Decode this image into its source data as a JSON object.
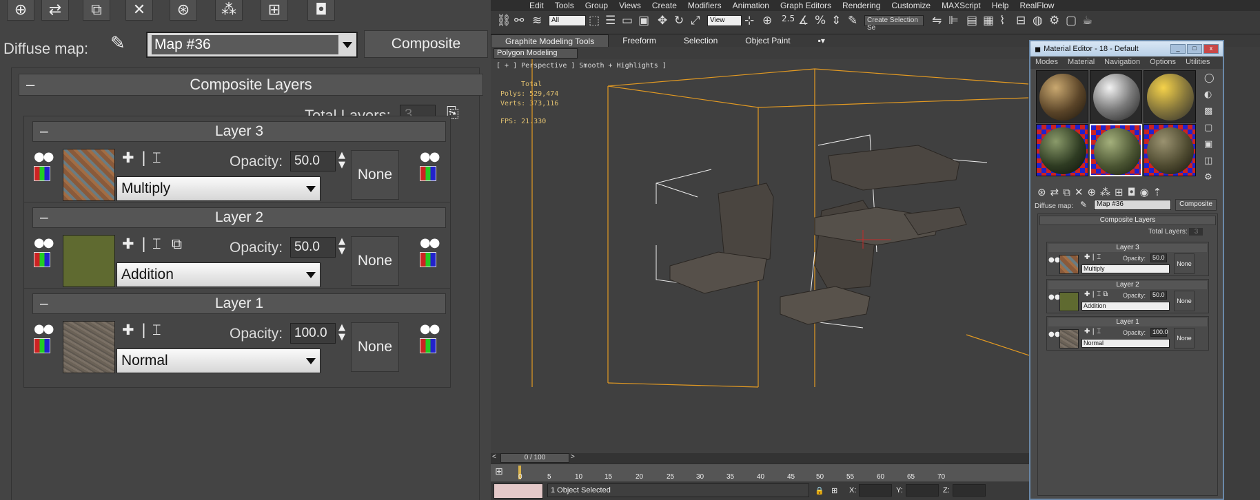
{
  "zoom": {
    "diffuse_label": "Diffuse map:",
    "map_value": "Map #36",
    "composite_button": "Composite",
    "rollout_title": "Composite Layers",
    "total_layers_label": "Total Layers:",
    "total_layers_value": "3",
    "layers": [
      {
        "title": "Layer 3",
        "opacity_label": "Opacity:",
        "opacity": "50.0",
        "blend": "Multiply",
        "mask": "None"
      },
      {
        "title": "Layer 2",
        "opacity_label": "Opacity:",
        "opacity": "50.0",
        "blend": "Addition",
        "mask": "None"
      },
      {
        "title": "Layer 1",
        "opacity_label": "Opacity:",
        "opacity": "100.0",
        "blend": "Normal",
        "mask": "None"
      }
    ]
  },
  "app": {
    "menu": [
      "Edit",
      "Tools",
      "Group",
      "Views",
      "Create",
      "Modifiers",
      "Animation",
      "Graph Editors",
      "Rendering",
      "Customize",
      "MAXScript",
      "Help",
      "RealFlow"
    ],
    "filter_select": "All",
    "view_select": "View",
    "selection_set_placeholder": "Create Selection Se",
    "ribbon_tabs": [
      "Graphite Modeling Tools",
      "Freeform",
      "Selection",
      "Object Paint"
    ],
    "polygon_modeling": "Polygon Modeling",
    "viewport_label": "[ + ] Perspective ] Smooth + Highlights ]",
    "stats": {
      "total": "Total",
      "polys": "Polys: 529,474",
      "verts": "Verts: 373,116",
      "fps": "FPS:   21.330"
    },
    "timeline": "0 / 100",
    "ticks": [
      "0",
      "5",
      "10",
      "15",
      "20",
      "25",
      "30",
      "35",
      "40",
      "45",
      "50",
      "55",
      "60",
      "65",
      "70"
    ],
    "status": "1 Object Selected",
    "x_label": "X:",
    "y_label": "Y:",
    "z_label": "Z:"
  },
  "material_editor": {
    "title": "Material Editor - 18 - Default",
    "menu": [
      "Modes",
      "Material",
      "Navigation",
      "Options",
      "Utilities"
    ],
    "diffuse_label": "Diffuse map:",
    "map_value": "Map #36",
    "composite_button": "Composite",
    "rollout_title": "Composite Layers",
    "total_layers_label": "Total Layers:",
    "total_layers_value": "3",
    "layers": [
      {
        "title": "Layer 3",
        "opacity_label": "Opacity:",
        "opacity": "50.0",
        "blend": "Multiply",
        "mask": "None"
      },
      {
        "title": "Layer 2",
        "opacity_label": "Opacity:",
        "opacity": "50.0",
        "blend": "Addition",
        "mask": "None"
      },
      {
        "title": "Layer 1",
        "opacity_label": "Opacity:",
        "opacity": "100.0",
        "blend": "Normal",
        "mask": "None"
      }
    ]
  }
}
